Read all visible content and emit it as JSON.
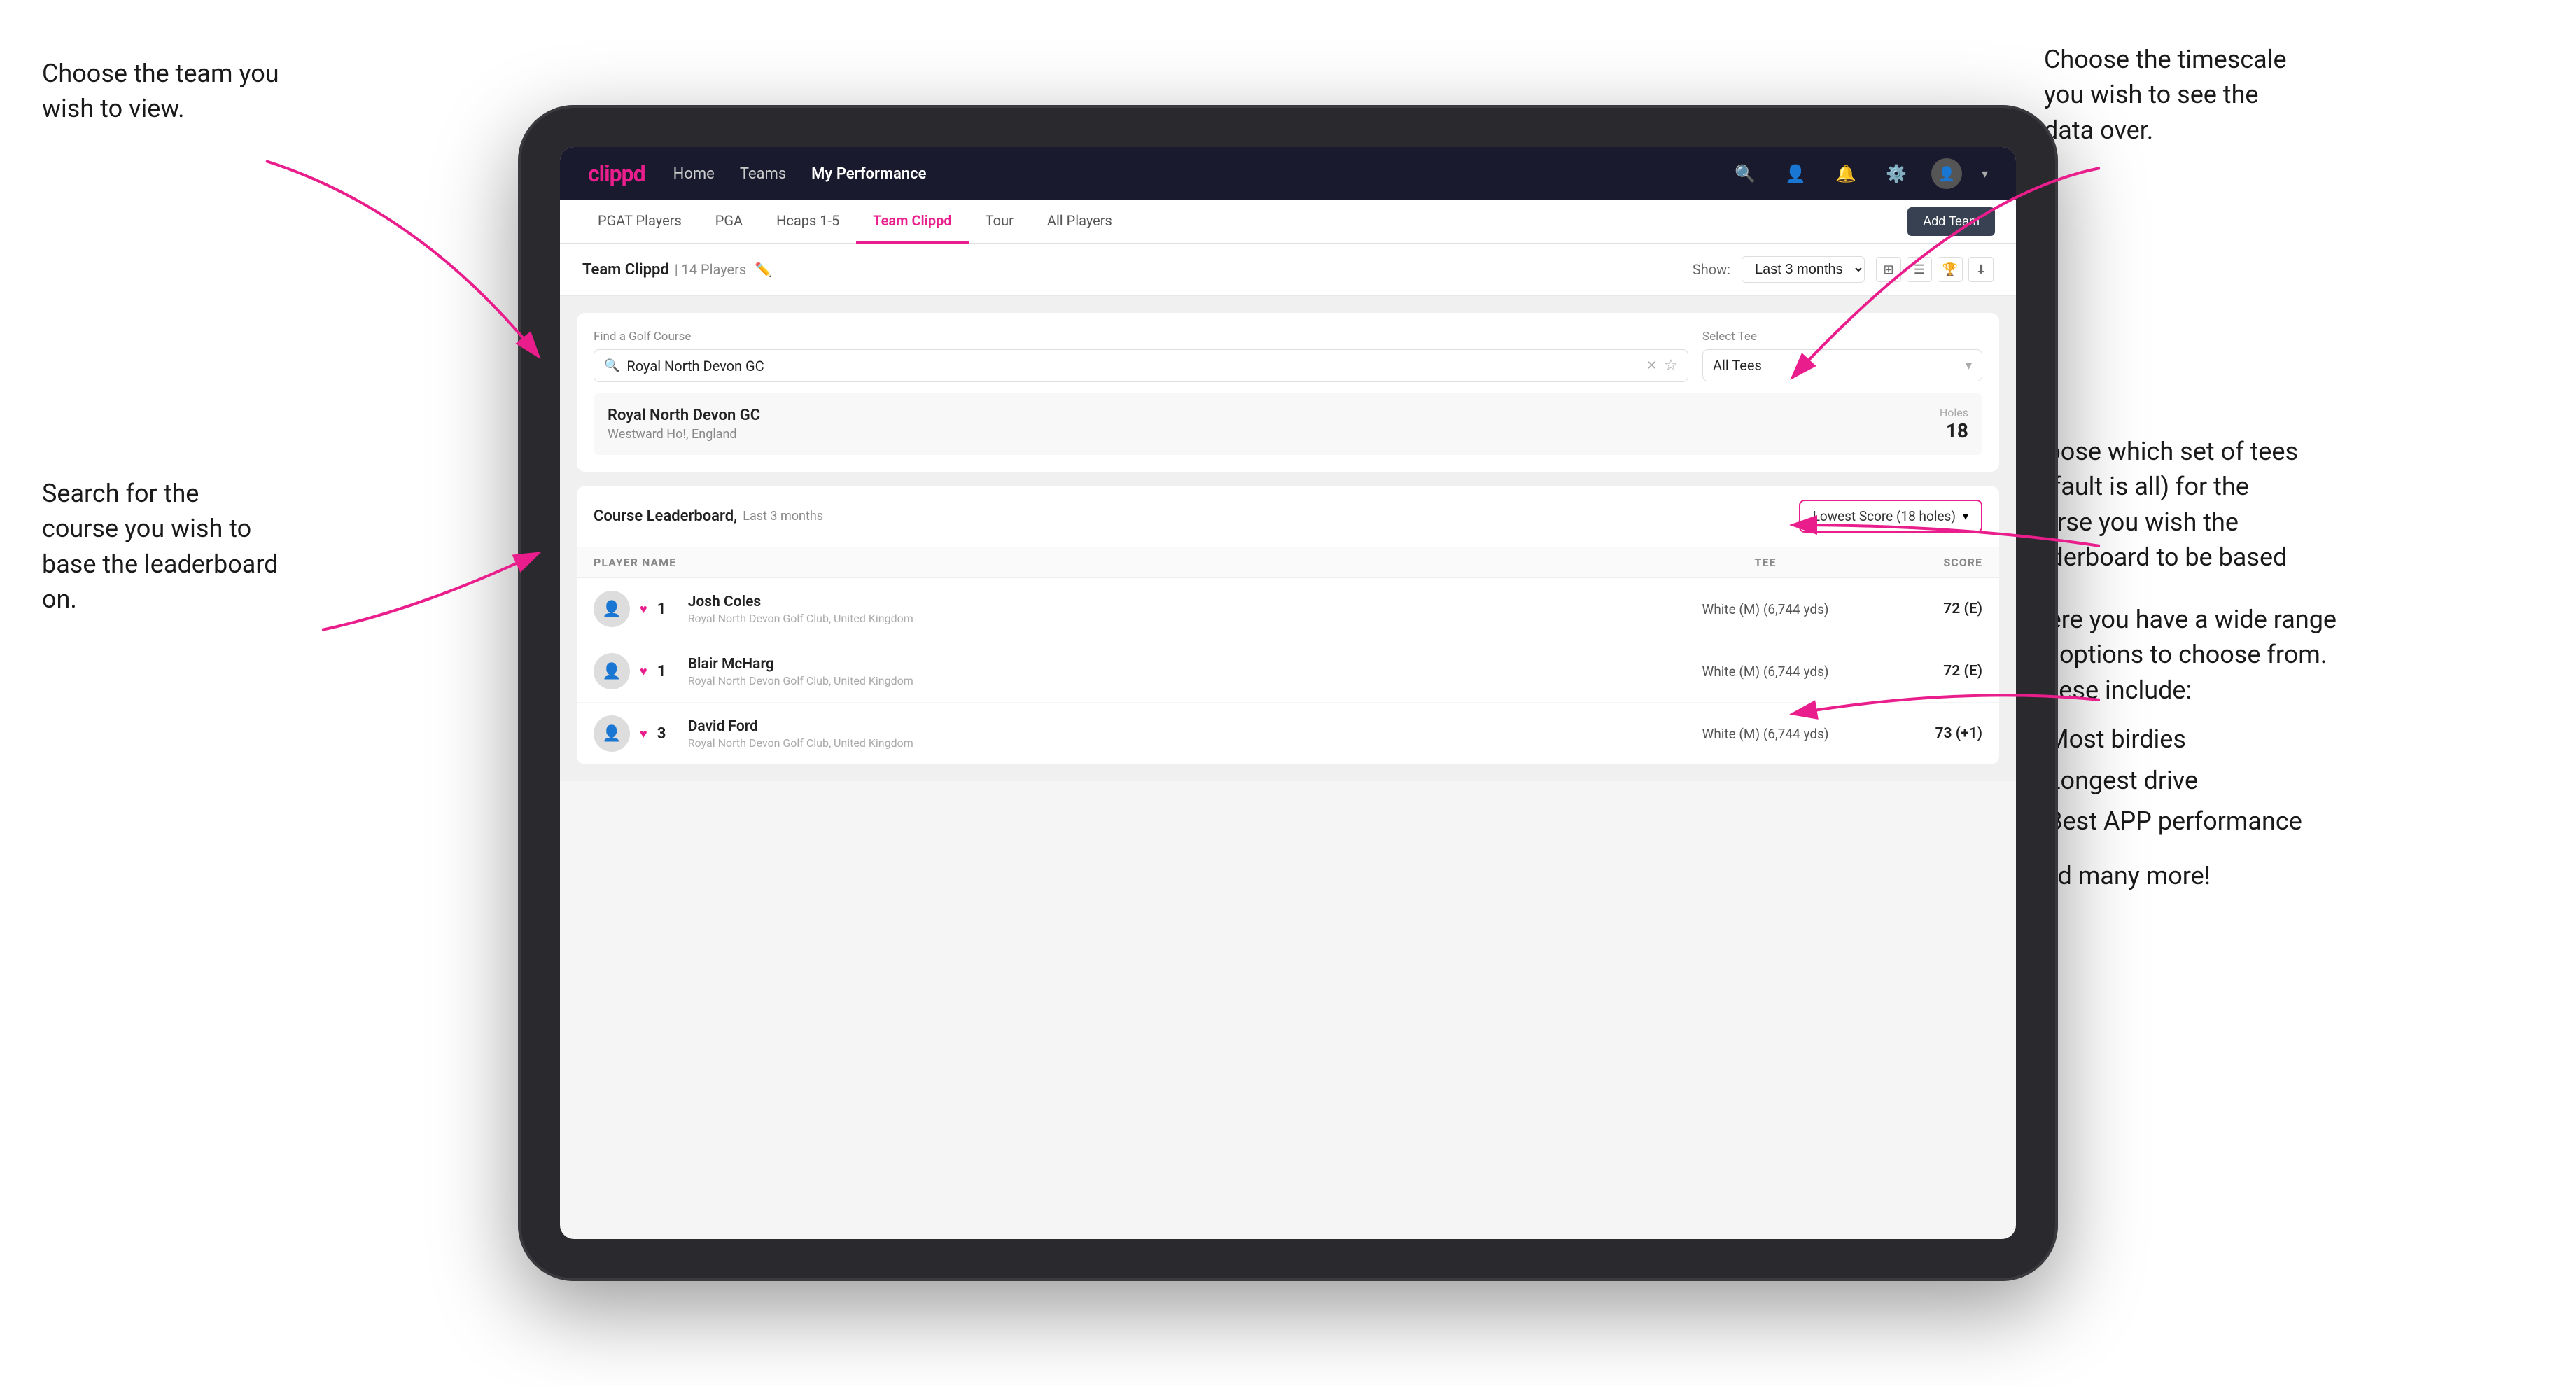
{
  "annotations": {
    "top_left": {
      "title": "Choose the team you wish to view."
    },
    "search": {
      "title": "Search for the course you wish to base the leaderboard on."
    },
    "top_right": {
      "title": "Choose the timescale you wish to see the data over."
    },
    "tees": {
      "title": "Choose which set of tees (default is all) for the course you wish the leaderboard to be based on."
    },
    "options": {
      "title": "Here you have a wide range of options to choose from. These include:",
      "bullets": [
        "Most birdies",
        "Longest drive",
        "Best APP performance"
      ],
      "and_more": "and many more!"
    }
  },
  "nav": {
    "logo": "clippd",
    "links": [
      {
        "label": "Home",
        "active": false
      },
      {
        "label": "Teams",
        "active": false
      },
      {
        "label": "My Performance",
        "active": true
      }
    ],
    "icons": [
      "search",
      "person",
      "bell",
      "settings",
      "avatar"
    ]
  },
  "sub_nav": {
    "items": [
      {
        "label": "PGAT Players",
        "active": false
      },
      {
        "label": "PGA",
        "active": false
      },
      {
        "label": "Hcaps 1-5",
        "active": false
      },
      {
        "label": "Team Clippd",
        "active": true
      },
      {
        "label": "Tour",
        "active": false
      },
      {
        "label": "All Players",
        "active": false
      }
    ],
    "add_team_btn": "Add Team"
  },
  "team_header": {
    "name": "Team Clippd",
    "count": "14 Players",
    "show_label": "Show:",
    "show_value": "Last 3 months",
    "views": [
      "grid",
      "list",
      "trophy",
      "download"
    ]
  },
  "course_search": {
    "label": "Find a Golf Course",
    "placeholder": "Royal North Devon GC",
    "tee_label": "Select Tee",
    "tee_value": "All Tees",
    "result": {
      "name": "Royal North Devon GC",
      "location": "Westward Ho!, England",
      "holes_label": "Holes",
      "holes_count": "18"
    }
  },
  "leaderboard": {
    "title": "Course Leaderboard,",
    "subtitle": "Last 3 months",
    "score_option": "Lowest Score (18 holes)",
    "columns": {
      "player": "PLAYER NAME",
      "tee": "TEE",
      "score": "SCORE"
    },
    "rows": [
      {
        "rank": "1",
        "name": "Josh Coles",
        "club": "Royal North Devon Golf Club, United Kingdom",
        "tee": "White (M) (6,744 yds)",
        "score": "72 (E)"
      },
      {
        "rank": "1",
        "name": "Blair McHarg",
        "club": "Royal North Devon Golf Club, United Kingdom",
        "tee": "White (M) (6,744 yds)",
        "score": "72 (E)"
      },
      {
        "rank": "3",
        "name": "David Ford",
        "club": "Royal North Devon Golf Club, United Kingdom",
        "tee": "White (M) (6,744 yds)",
        "score": "73 (+1)"
      }
    ]
  }
}
